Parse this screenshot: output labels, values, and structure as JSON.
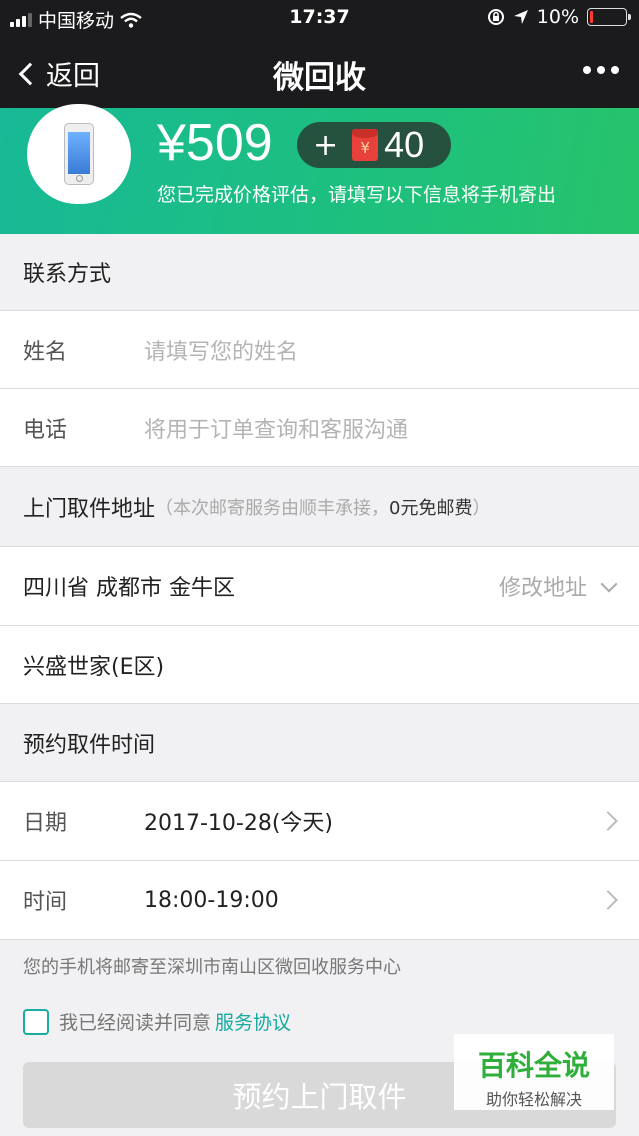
{
  "status": {
    "carrier": "中国移动",
    "time": "17:37",
    "battery": "10%",
    "battery_level": 0.1
  },
  "nav": {
    "back_label": "返回",
    "title": "微回收"
  },
  "banner": {
    "price": "¥509",
    "bonus_plus": "+",
    "bonus_symbol": "¥",
    "bonus_amount": "40",
    "subtitle": "您已完成价格评估，请填写以下信息将手机寄出"
  },
  "contact": {
    "heading": "联系方式",
    "name_label": "姓名",
    "name_placeholder": "请填写您的姓名",
    "phone_label": "电话",
    "phone_placeholder": "将用于订单查询和客服沟通"
  },
  "address": {
    "heading": "上门取件地址",
    "hint_prefix": "（本次邮寄服务由顺丰承接，",
    "hint_free": "0元免邮费",
    "hint_suffix": "）",
    "region": "四川省 成都市 金牛区",
    "change_label": "修改地址",
    "detail": "兴盛世家(E区)"
  },
  "schedule": {
    "heading": "预约取件时间",
    "date_label": "日期",
    "date_value": "2017-10-28(今天)",
    "time_label": "时间",
    "time_value": "18:00-19:00"
  },
  "footer": {
    "note": "您的手机将邮寄至深圳市南山区微回收服务中心",
    "agree_text": "我已经阅读并同意",
    "agree_link": "服务协议",
    "submit_label": "预约上门取件"
  },
  "watermark": {
    "title": "百科全说",
    "subtitle": "助你轻松解决"
  },
  "colors": {
    "accent": "#1ec07d",
    "link": "#18a9a0",
    "dark": "#1b1b1d"
  }
}
